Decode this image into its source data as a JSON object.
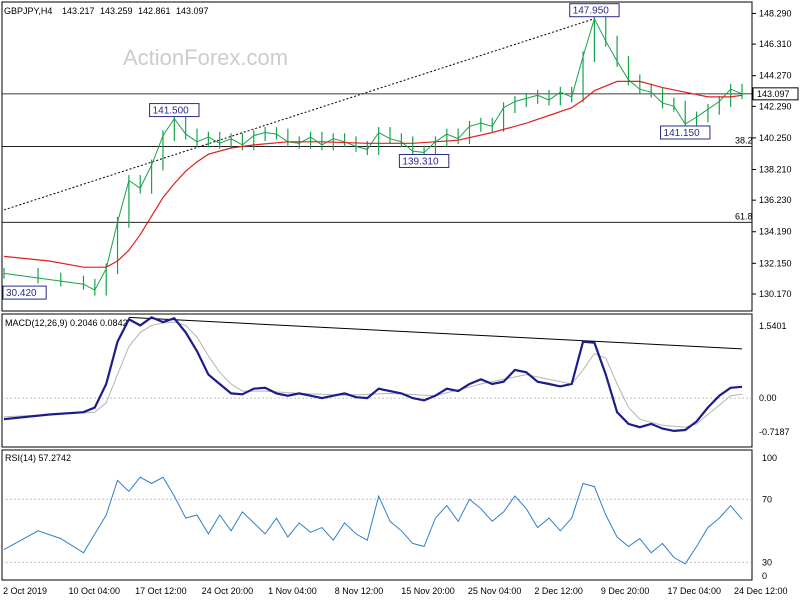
{
  "chart_data": {
    "type": "line",
    "symbol_line": {
      "symbol": "GBPJPY,H4",
      "ohlc": [
        "143.217",
        "143.259",
        "142.861",
        "143.097"
      ]
    },
    "watermark": "ActionForex.com",
    "x_labels": [
      "2 Oct 2019",
      "10 Oct 04:00",
      "17 Oct 12:00",
      "24 Oct 20:00",
      "1 Nov 04:00",
      "8 Nov 12:00",
      "15 Nov 20:00",
      "25 Nov 04:00",
      "2 Dec 12:00",
      "9 Dec 20:00",
      "17 Dec 04:00",
      "24 Dec 12:00"
    ],
    "price_panel": {
      "ylim": [
        129.2,
        148.9
      ],
      "y_ticks": [
        "148.290",
        "146.310",
        "144.270",
        "142.290",
        "140.250",
        "138.210",
        "136.230",
        "134.190",
        "132.150",
        "130.170"
      ],
      "current_price": "143.097",
      "price_series": [
        {
          "t": 0,
          "v": 131.5
        },
        {
          "t": 3,
          "v": 131.2
        },
        {
          "t": 5,
          "v": 131.0
        },
        {
          "t": 7,
          "v": 130.8
        },
        {
          "t": 8,
          "v": 130.42
        },
        {
          "t": 9,
          "v": 131.8
        },
        {
          "t": 10,
          "v": 134.8
        },
        {
          "t": 11,
          "v": 137.5
        },
        {
          "t": 12,
          "v": 137.0
        },
        {
          "t": 13,
          "v": 138.5
        },
        {
          "t": 14,
          "v": 140.4
        },
        {
          "t": 15,
          "v": 141.5
        },
        {
          "t": 16,
          "v": 140.5
        },
        {
          "t": 17,
          "v": 140.0
        },
        {
          "t": 18,
          "v": 140.3
        },
        {
          "t": 19,
          "v": 139.9
        },
        {
          "t": 20,
          "v": 140.2
        },
        {
          "t": 21,
          "v": 139.8
        },
        {
          "t": 22,
          "v": 140.4
        },
        {
          "t": 23,
          "v": 140.6
        },
        {
          "t": 24,
          "v": 140.5
        },
        {
          "t": 25,
          "v": 140.0
        },
        {
          "t": 26,
          "v": 139.9
        },
        {
          "t": 27,
          "v": 140.3
        },
        {
          "t": 28,
          "v": 139.8
        },
        {
          "t": 29,
          "v": 140.2
        },
        {
          "t": 30,
          "v": 140.0
        },
        {
          "t": 31,
          "v": 139.7
        },
        {
          "t": 32,
          "v": 139.5
        },
        {
          "t": 33,
          "v": 140.6
        },
        {
          "t": 34,
          "v": 140.2
        },
        {
          "t": 35,
          "v": 140.0
        },
        {
          "t": 36,
          "v": 139.4
        },
        {
          "t": 37,
          "v": 139.31
        },
        {
          "t": 38,
          "v": 140.0
        },
        {
          "t": 39,
          "v": 140.5
        },
        {
          "t": 40,
          "v": 140.2
        },
        {
          "t": 41,
          "v": 141.0
        },
        {
          "t": 42,
          "v": 141.2
        },
        {
          "t": 43,
          "v": 141.0
        },
        {
          "t": 44,
          "v": 142.2
        },
        {
          "t": 45,
          "v": 142.6
        },
        {
          "t": 46,
          "v": 142.8
        },
        {
          "t": 47,
          "v": 143.0
        },
        {
          "t": 48,
          "v": 142.7
        },
        {
          "t": 49,
          "v": 143.2
        },
        {
          "t": 50,
          "v": 142.9
        },
        {
          "t": 51,
          "v": 145.5
        },
        {
          "t": 52,
          "v": 147.95
        },
        {
          "t": 53,
          "v": 146.5
        },
        {
          "t": 54,
          "v": 145.2
        },
        {
          "t": 55,
          "v": 144.0
        },
        {
          "t": 56,
          "v": 143.4
        },
        {
          "t": 57,
          "v": 143.2
        },
        {
          "t": 58,
          "v": 142.5
        },
        {
          "t": 59,
          "v": 142.3
        },
        {
          "t": 60,
          "v": 141.15
        },
        {
          "t": 61,
          "v": 141.6
        },
        {
          "t": 62,
          "v": 142.1
        },
        {
          "t": 63,
          "v": 142.6
        },
        {
          "t": 64,
          "v": 143.4
        },
        {
          "t": 65,
          "v": 143.097
        }
      ],
      "ma_series": [
        {
          "t": 0,
          "v": 132.6
        },
        {
          "t": 4,
          "v": 132.3
        },
        {
          "t": 7,
          "v": 131.9
        },
        {
          "t": 9,
          "v": 131.9
        },
        {
          "t": 10,
          "v": 132.3
        },
        {
          "t": 11,
          "v": 133.0
        },
        {
          "t": 12,
          "v": 134.0
        },
        {
          "t": 13,
          "v": 135.2
        },
        {
          "t": 14,
          "v": 136.4
        },
        {
          "t": 15,
          "v": 137.3
        },
        {
          "t": 16,
          "v": 138.1
        },
        {
          "t": 17,
          "v": 138.7
        },
        {
          "t": 18,
          "v": 139.2
        },
        {
          "t": 20,
          "v": 139.6
        },
        {
          "t": 22,
          "v": 139.8
        },
        {
          "t": 25,
          "v": 140.0
        },
        {
          "t": 28,
          "v": 140.0
        },
        {
          "t": 32,
          "v": 139.9
        },
        {
          "t": 36,
          "v": 139.9
        },
        {
          "t": 40,
          "v": 140.1
        },
        {
          "t": 43,
          "v": 140.6
        },
        {
          "t": 46,
          "v": 141.2
        },
        {
          "t": 48,
          "v": 141.7
        },
        {
          "t": 50,
          "v": 142.2
        },
        {
          "t": 51,
          "v": 142.7
        },
        {
          "t": 52,
          "v": 143.3
        },
        {
          "t": 54,
          "v": 143.9
        },
        {
          "t": 56,
          "v": 143.9
        },
        {
          "t": 58,
          "v": 143.5
        },
        {
          "t": 60,
          "v": 143.2
        },
        {
          "t": 62,
          "v": 142.9
        },
        {
          "t": 64,
          "v": 142.9
        },
        {
          "t": 65,
          "v": 143.0
        }
      ],
      "trend_line": [
        {
          "t": 0,
          "v": 135.6
        },
        {
          "t": 52,
          "v": 147.95
        }
      ],
      "h_levels": [
        {
          "value": 143.097
        },
        {
          "value": 139.7,
          "label": "38.2"
        },
        {
          "value": 134.8,
          "label": "61.8"
        }
      ],
      "annotations": [
        {
          "text": "147.950",
          "t": 52,
          "v": 147.95
        },
        {
          "text": "141.500",
          "t": 15,
          "v": 141.5
        },
        {
          "text": "139.310",
          "t": 37,
          "v": 139.31
        },
        {
          "text": "141.150",
          "t": 60,
          "v": 141.15
        },
        {
          "text": "30.420",
          "t": 3,
          "v": 130.42
        }
      ]
    },
    "macd_panel": {
      "title": "MACD(12,26,9) 0.2046 0.0842",
      "ylim": [
        -1.0,
        1.75
      ],
      "y_ticks": [
        "1.5401",
        "0.00",
        "-0.7187"
      ],
      "macd_series": [
        {
          "t": 0,
          "v": -0.45
        },
        {
          "t": 4,
          "v": -0.35
        },
        {
          "t": 7,
          "v": -0.3
        },
        {
          "t": 8,
          "v": -0.2
        },
        {
          "t": 9,
          "v": 0.3
        },
        {
          "t": 10,
          "v": 1.2
        },
        {
          "t": 11,
          "v": 1.68
        },
        {
          "t": 12,
          "v": 1.55
        },
        {
          "t": 13,
          "v": 1.72
        },
        {
          "t": 14,
          "v": 1.62
        },
        {
          "t": 15,
          "v": 1.7
        },
        {
          "t": 16,
          "v": 1.4
        },
        {
          "t": 17,
          "v": 1.0
        },
        {
          "t": 18,
          "v": 0.5
        },
        {
          "t": 19,
          "v": 0.3
        },
        {
          "t": 20,
          "v": 0.1
        },
        {
          "t": 21,
          "v": 0.08
        },
        {
          "t": 22,
          "v": 0.2
        },
        {
          "t": 23,
          "v": 0.22
        },
        {
          "t": 24,
          "v": 0.1
        },
        {
          "t": 25,
          "v": 0.05
        },
        {
          "t": 26,
          "v": 0.1
        },
        {
          "t": 27,
          "v": 0.05
        },
        {
          "t": 28,
          "v": 0.0
        },
        {
          "t": 29,
          "v": 0.05
        },
        {
          "t": 30,
          "v": 0.1
        },
        {
          "t": 31,
          "v": 0.02
        },
        {
          "t": 32,
          "v": 0.0
        },
        {
          "t": 33,
          "v": 0.2
        },
        {
          "t": 34,
          "v": 0.15
        },
        {
          "t": 35,
          "v": 0.1
        },
        {
          "t": 36,
          "v": 0.0
        },
        {
          "t": 37,
          "v": -0.05
        },
        {
          "t": 38,
          "v": 0.05
        },
        {
          "t": 39,
          "v": 0.2
        },
        {
          "t": 40,
          "v": 0.15
        },
        {
          "t": 41,
          "v": 0.3
        },
        {
          "t": 42,
          "v": 0.4
        },
        {
          "t": 43,
          "v": 0.3
        },
        {
          "t": 44,
          "v": 0.35
        },
        {
          "t": 45,
          "v": 0.6
        },
        {
          "t": 46,
          "v": 0.55
        },
        {
          "t": 47,
          "v": 0.35
        },
        {
          "t": 48,
          "v": 0.3
        },
        {
          "t": 49,
          "v": 0.25
        },
        {
          "t": 50,
          "v": 0.3
        },
        {
          "t": 51,
          "v": 1.2
        },
        {
          "t": 52,
          "v": 1.18
        },
        {
          "t": 53,
          "v": 0.5
        },
        {
          "t": 54,
          "v": -0.3
        },
        {
          "t": 55,
          "v": -0.55
        },
        {
          "t": 56,
          "v": -0.62
        },
        {
          "t": 57,
          "v": -0.55
        },
        {
          "t": 58,
          "v": -0.65
        },
        {
          "t": 59,
          "v": -0.7
        },
        {
          "t": 60,
          "v": -0.68
        },
        {
          "t": 61,
          "v": -0.5
        },
        {
          "t": 62,
          "v": -0.2
        },
        {
          "t": 63,
          "v": 0.05
        },
        {
          "t": 64,
          "v": 0.22
        },
        {
          "t": 65,
          "v": 0.24
        }
      ],
      "signal_series": [
        {
          "t": 0,
          "v": -0.4
        },
        {
          "t": 8,
          "v": -0.3
        },
        {
          "t": 9,
          "v": -0.1
        },
        {
          "t": 10,
          "v": 0.5
        },
        {
          "t": 11,
          "v": 1.1
        },
        {
          "t": 12,
          "v": 1.4
        },
        {
          "t": 13,
          "v": 1.55
        },
        {
          "t": 14,
          "v": 1.6
        },
        {
          "t": 15,
          "v": 1.62
        },
        {
          "t": 16,
          "v": 1.55
        },
        {
          "t": 17,
          "v": 1.3
        },
        {
          "t": 18,
          "v": 0.9
        },
        {
          "t": 19,
          "v": 0.55
        },
        {
          "t": 20,
          "v": 0.3
        },
        {
          "t": 21,
          "v": 0.15
        },
        {
          "t": 23,
          "v": 0.15
        },
        {
          "t": 26,
          "v": 0.1
        },
        {
          "t": 30,
          "v": 0.06
        },
        {
          "t": 34,
          "v": 0.1
        },
        {
          "t": 38,
          "v": 0.05
        },
        {
          "t": 42,
          "v": 0.3
        },
        {
          "t": 46,
          "v": 0.5
        },
        {
          "t": 50,
          "v": 0.3
        },
        {
          "t": 51,
          "v": 0.6
        },
        {
          "t": 52,
          "v": 0.95
        },
        {
          "t": 53,
          "v": 0.85
        },
        {
          "t": 54,
          "v": 0.3
        },
        {
          "t": 55,
          "v": -0.2
        },
        {
          "t": 56,
          "v": -0.45
        },
        {
          "t": 58,
          "v": -0.58
        },
        {
          "t": 60,
          "v": -0.62
        },
        {
          "t": 61,
          "v": -0.55
        },
        {
          "t": 62,
          "v": -0.35
        },
        {
          "t": 63,
          "v": -0.15
        },
        {
          "t": 64,
          "v": 0.05
        },
        {
          "t": 65,
          "v": 0.084
        }
      ],
      "trend_line": [
        {
          "t": 11,
          "v": 1.72
        },
        {
          "t": 65,
          "v": 1.05
        }
      ]
    },
    "rsi_panel": {
      "title": "RSI(14) 57.2742",
      "ylim": [
        20,
        100
      ],
      "y_ticks": [
        "100",
        "70",
        "30",
        "0"
      ],
      "levels": [
        70,
        30
      ],
      "rsi_series": [
        {
          "t": 0,
          "v": 38
        },
        {
          "t": 3,
          "v": 50
        },
        {
          "t": 5,
          "v": 45
        },
        {
          "t": 7,
          "v": 36
        },
        {
          "t": 8,
          "v": 48
        },
        {
          "t": 9,
          "v": 60
        },
        {
          "t": 10,
          "v": 82
        },
        {
          "t": 11,
          "v": 75
        },
        {
          "t": 12,
          "v": 84
        },
        {
          "t": 13,
          "v": 80
        },
        {
          "t": 14,
          "v": 84
        },
        {
          "t": 15,
          "v": 72
        },
        {
          "t": 16,
          "v": 58
        },
        {
          "t": 17,
          "v": 60
        },
        {
          "t": 18,
          "v": 48
        },
        {
          "t": 19,
          "v": 60
        },
        {
          "t": 20,
          "v": 50
        },
        {
          "t": 21,
          "v": 62
        },
        {
          "t": 22,
          "v": 55
        },
        {
          "t": 23,
          "v": 48
        },
        {
          "t": 24,
          "v": 58
        },
        {
          "t": 25,
          "v": 46
        },
        {
          "t": 26,
          "v": 55
        },
        {
          "t": 27,
          "v": 49
        },
        {
          "t": 28,
          "v": 52
        },
        {
          "t": 29,
          "v": 44
        },
        {
          "t": 30,
          "v": 55
        },
        {
          "t": 31,
          "v": 48
        },
        {
          "t": 32,
          "v": 44
        },
        {
          "t": 33,
          "v": 72
        },
        {
          "t": 34,
          "v": 56
        },
        {
          "t": 35,
          "v": 50
        },
        {
          "t": 36,
          "v": 42
        },
        {
          "t": 37,
          "v": 40
        },
        {
          "t": 38,
          "v": 58
        },
        {
          "t": 39,
          "v": 66
        },
        {
          "t": 40,
          "v": 56
        },
        {
          "t": 41,
          "v": 70
        },
        {
          "t": 42,
          "v": 64
        },
        {
          "t": 43,
          "v": 56
        },
        {
          "t": 44,
          "v": 62
        },
        {
          "t": 45,
          "v": 72
        },
        {
          "t": 46,
          "v": 64
        },
        {
          "t": 47,
          "v": 52
        },
        {
          "t": 48,
          "v": 58
        },
        {
          "t": 49,
          "v": 50
        },
        {
          "t": 50,
          "v": 58
        },
        {
          "t": 51,
          "v": 80
        },
        {
          "t": 52,
          "v": 78
        },
        {
          "t": 53,
          "v": 60
        },
        {
          "t": 54,
          "v": 46
        },
        {
          "t": 55,
          "v": 40
        },
        {
          "t": 56,
          "v": 45
        },
        {
          "t": 57,
          "v": 36
        },
        {
          "t": 58,
          "v": 42
        },
        {
          "t": 59,
          "v": 33
        },
        {
          "t": 60,
          "v": 29
        },
        {
          "t": 61,
          "v": 40
        },
        {
          "t": 62,
          "v": 52
        },
        {
          "t": 63,
          "v": 58
        },
        {
          "t": 64,
          "v": 66
        },
        {
          "t": 65,
          "v": 57.27
        }
      ]
    },
    "colors": {
      "price": "#16a34a",
      "ma": "#e02020",
      "macd": "#1c1c8c",
      "signal": "#b4b4b4",
      "rsi": "#2f7fd0",
      "level": "#000000",
      "box_border": "#2b2b8a",
      "watermark": "#c8c8c8"
    }
  }
}
